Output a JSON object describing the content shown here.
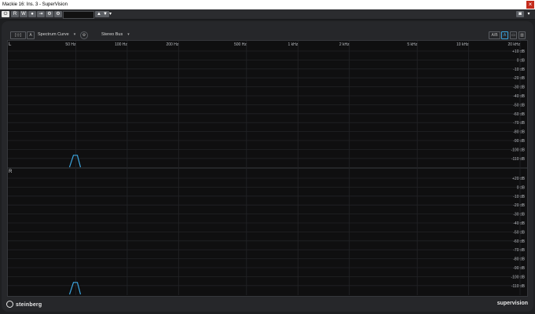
{
  "window": {
    "title": "Mackie 16: Ins. 3 - SuperVision",
    "close_glyph": "×"
  },
  "host_toolbar": {
    "read_label": "R",
    "write_label": "W",
    "preset_value": ""
  },
  "plugin": {
    "module_label": "Spectrum Curve",
    "bus_label": "Stereo Bus",
    "a_label": "A",
    "compare_label": "A/B"
  },
  "display": {
    "freq_labels": [
      "50 Hz",
      "100 Hz",
      "200 Hz",
      "500 Hz",
      "1 kHz",
      "2 kHz",
      "5 kHz",
      "10 kHz",
      "20 kHz"
    ],
    "db_labels": [
      "+10 dB",
      "0 dB",
      "-10 dB",
      "-20 dB",
      "-30 dB",
      "-40 dB",
      "-50 dB",
      "-60 dB",
      "-70 dB",
      "-80 dB",
      "-90 dB",
      "-100 dB",
      "-110 dB"
    ],
    "top_db_first": "+10 dB",
    "bottom_db_first": "+20 dB",
    "channels": [
      {
        "id": "L",
        "label": "L"
      },
      {
        "id": "R",
        "label": "R"
      }
    ],
    "accent_color": "#3ca6e0",
    "peak_freq_hz": 50,
    "peak_level_db": -110
  },
  "footer": {
    "brand": "steinberg",
    "product": "supervision"
  }
}
